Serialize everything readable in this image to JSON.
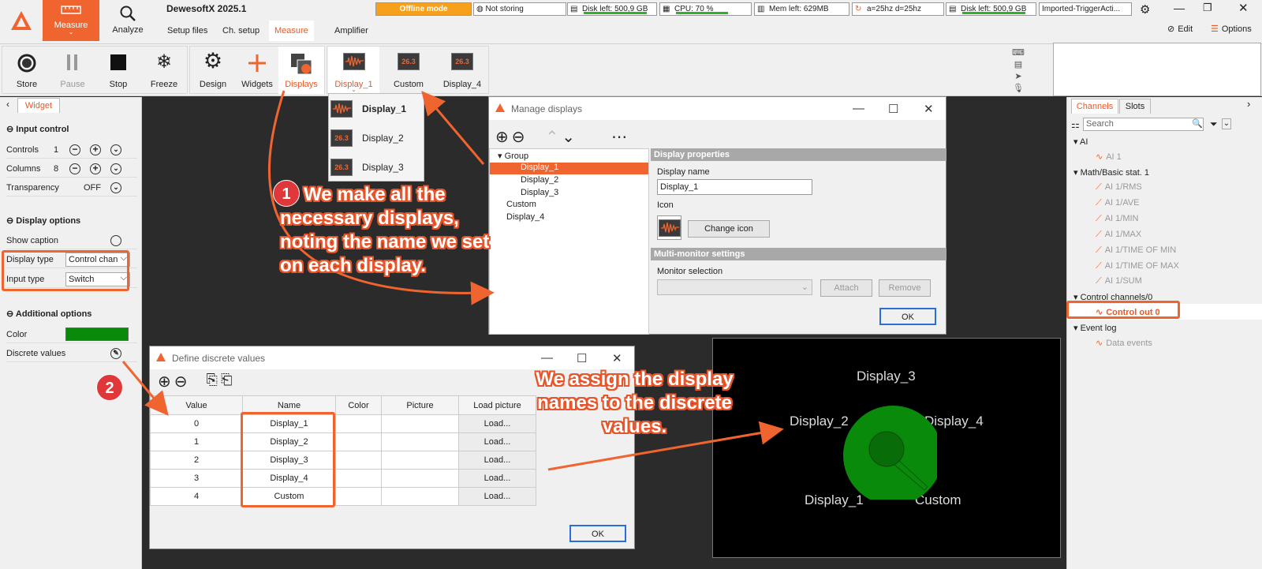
{
  "app": {
    "title": "DewesoftX 2025.1",
    "modes": [
      {
        "label": "Measure"
      },
      {
        "label": "Analyze"
      }
    ],
    "menu_tabs": [
      "Setup files",
      "Ch. setup",
      "Measure",
      "Amplifier"
    ],
    "status": {
      "offline": "Offline mode",
      "storing": "Not storing",
      "disk1": "Disk left: 500,9 GB",
      "cpu": "CPU: 70 %",
      "cpu_fraction": 0.7,
      "mem": "Mem left: 629MB",
      "rate": "a=25hz d=25hz",
      "disk2": "Disk left: 500,9 GB",
      "file": "Imported-TriggerActi..."
    },
    "edit_label": "Edit",
    "options_label": "Options"
  },
  "toolbar": {
    "store": "Store",
    "pause": "Pause",
    "stop": "Stop",
    "freeze": "Freeze",
    "design": "Design",
    "widgets": "Widgets",
    "displays": "Displays",
    "display_tabs": [
      {
        "label": "Display_1"
      },
      {
        "label": "Custom"
      },
      {
        "label": "Display_4"
      }
    ],
    "display_icon_text": "26.3"
  },
  "dropdown": {
    "items": [
      "Display_1",
      "Display_2",
      "Display_3"
    ]
  },
  "left_panel": {
    "tab": "Widget",
    "input_control": {
      "title": "Input control",
      "controls_label": "Controls",
      "controls_value": "1",
      "columns_label": "Columns",
      "columns_value": "8",
      "transparency_label": "Transparency",
      "transparency_value": "OFF"
    },
    "display_options": {
      "title": "Display options",
      "show_caption": "Show caption",
      "display_type_label": "Display type",
      "display_type_value": "Control chan",
      "input_type_label": "Input type",
      "input_type_value": "Switch"
    },
    "additional_options": {
      "title": "Additional options",
      "color_label": "Color",
      "color_value": "#0a8a0a",
      "discrete_label": "Discrete values"
    }
  },
  "manage_displays": {
    "title": "Manage displays",
    "tree": {
      "group": "Group",
      "group_children": [
        "Display_1",
        "Display_2",
        "Display_3"
      ],
      "others": [
        "Custom",
        "Display_4"
      ]
    },
    "props_header": "Display properties",
    "display_name_label": "Display name",
    "display_name_value": "Display_1",
    "icon_label": "Icon",
    "change_icon": "Change icon",
    "multi_header": "Multi-monitor settings",
    "monitor_label": "Monitor selection",
    "attach": "Attach",
    "remove": "Remove",
    "ok": "OK"
  },
  "discrete_values": {
    "title": "Define discrete values",
    "columns": [
      "Value",
      "Name",
      "Color",
      "Picture",
      "Load picture"
    ],
    "rows": [
      {
        "value": "0",
        "name": "Display_1",
        "load": "Load..."
      },
      {
        "value": "1",
        "name": "Display_2",
        "load": "Load..."
      },
      {
        "value": "2",
        "name": "Display_3",
        "load": "Load..."
      },
      {
        "value": "3",
        "name": "Display_4",
        "load": "Load..."
      },
      {
        "value": "4",
        "name": "Custom",
        "load": "Load..."
      }
    ],
    "ok": "OK"
  },
  "right_panel": {
    "tabs": [
      "Channels",
      "Slots"
    ],
    "search_placeholder": "Search",
    "groups": [
      {
        "name": "AI",
        "children": [
          "AI 1"
        ]
      },
      {
        "name": "Math/Basic stat. 1",
        "children": [
          "AI 1/RMS",
          "AI 1/AVE",
          "AI 1/MIN",
          "AI 1/MAX",
          "AI 1/TIME OF MIN",
          "AI 1/TIME OF MAX",
          "AI 1/SUM"
        ]
      },
      {
        "name": "Control channels/0",
        "children": [
          "Control out 0"
        ]
      },
      {
        "name": "Event log",
        "children": [
          "Data events"
        ]
      }
    ]
  },
  "switch_display": {
    "labels": [
      "Display_3",
      "Display_2",
      "Display_4",
      "Display_1",
      "Custom"
    ],
    "knob_color": "#0a8a0a"
  },
  "annotations": {
    "step1_badge": "1",
    "step1_text": "We make all the necessary displays, noting the name we set on each display.",
    "step2_badge": "2",
    "step3_text": "We assign the display names to the discrete values."
  }
}
